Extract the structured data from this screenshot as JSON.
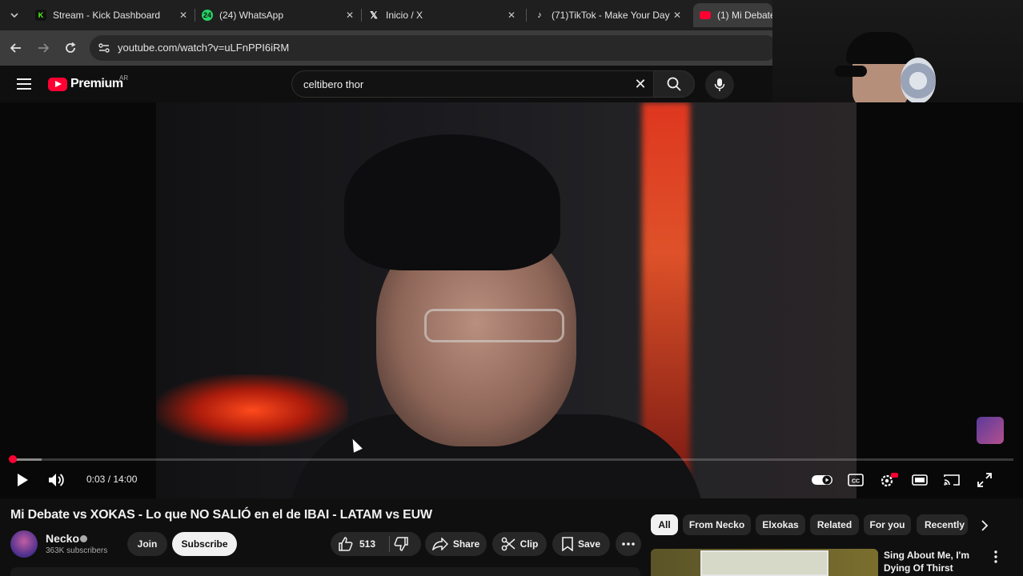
{
  "browser": {
    "tabs": [
      {
        "title": "Stream - Kick Dashboard",
        "icon": "kick-icon",
        "color": "#53fc18"
      },
      {
        "title": "(24) WhatsApp",
        "icon": "whatsapp-icon",
        "badge": "24",
        "color": "#25d366"
      },
      {
        "title": "Inicio / X",
        "icon": "x-icon",
        "color": "#ffffff"
      },
      {
        "title": "(71)TikTok - Make Your Day",
        "icon": "tiktok-icon",
        "color": "#ffffff"
      },
      {
        "title": "(1) Mi Debate",
        "icon": "youtube-icon",
        "color": "#ff0033"
      }
    ],
    "url": "youtube.com/watch?v=uLFnPPI6iRM"
  },
  "youtube": {
    "logo_text": "Premium",
    "region": "AR",
    "search_query": "celtibero thor",
    "brand_color": "#ff0033"
  },
  "player": {
    "time_display": "0:03 / 14:00",
    "current_seconds": 3,
    "duration_seconds": 840
  },
  "video": {
    "title": "Mi Debate vs XOKAS - Lo que NO SALIÓ en el de IBAI - LATAM vs EUW",
    "channel": "Necko",
    "subscribers": "363K subscribers",
    "join_label": "Join",
    "subscribe_label": "Subscribe",
    "like_count": "513",
    "share_label": "Share",
    "clip_label": "Clip",
    "save_label": "Save"
  },
  "sidebar": {
    "chips": [
      "All",
      "From Necko",
      "Elxokas",
      "Related",
      "For you",
      "Recently"
    ],
    "recommendation": {
      "title": "Sing About Me, I'm Dying Of Thirst"
    }
  }
}
